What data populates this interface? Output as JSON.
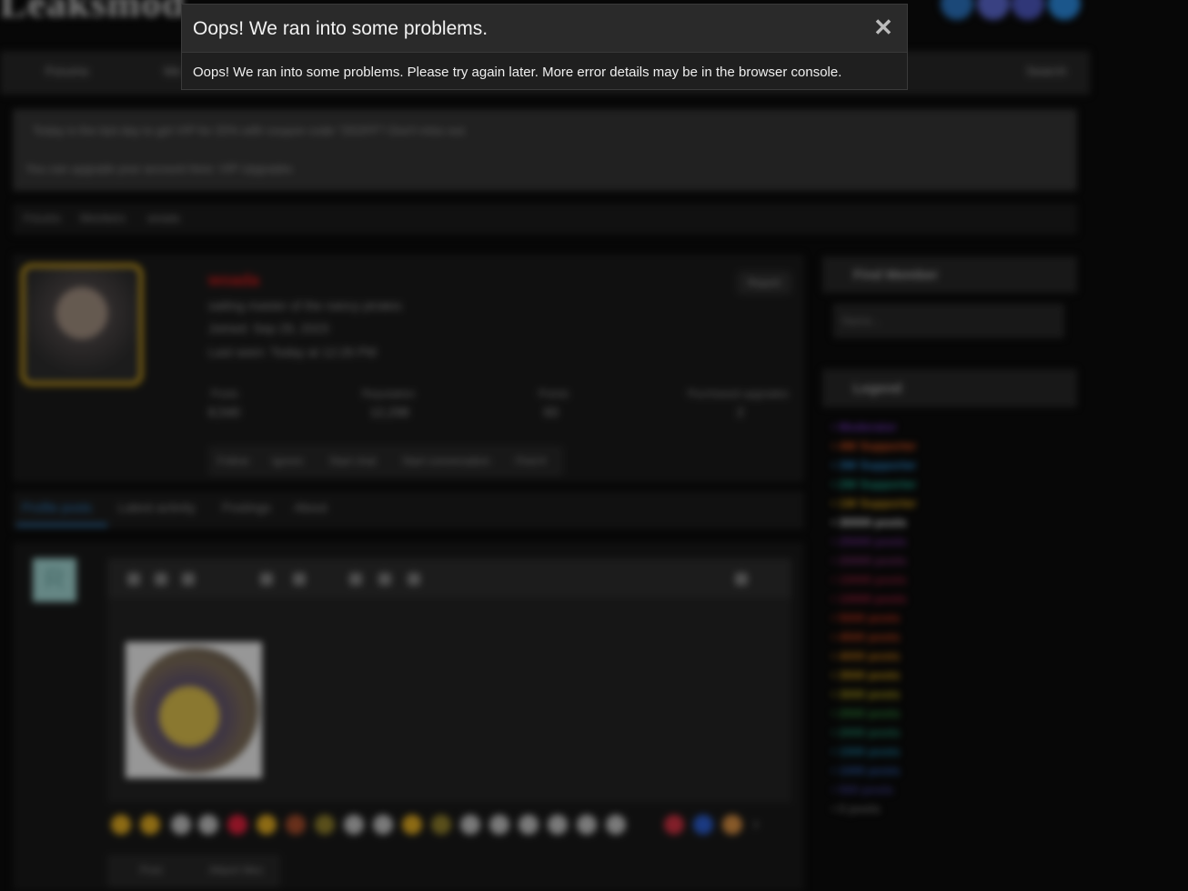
{
  "modal": {
    "title": "Oops! We ran into some problems.",
    "close_glyph": "✕",
    "message": "Oops! We ran into some problems. Please try again later. More error details may be in the browser console."
  },
  "background": {
    "logo_text": "Leaksmod",
    "nav": {
      "forums": "Forums",
      "media": "Me",
      "search": "Search"
    },
    "notice": {
      "line1": "Today is the last day to get VIP for 25% with coupon code \"25OFF\"! Don't miss out.",
      "line2": "You can upgrade your account here: VIP Upgrades"
    },
    "breadcrumb": [
      "Forums",
      "Members",
      "woada"
    ],
    "profile": {
      "username": "woada",
      "title": "sailing master of the nancy pirates",
      "joined": "Joined: Sep 29, 2023",
      "last_seen": "Last seen: Today at 12:26 PM",
      "report": "Report",
      "stats": [
        {
          "label": "Posts",
          "value": "8,540"
        },
        {
          "label": "Reputation",
          "value": "12,298"
        },
        {
          "label": "Points",
          "value": "83"
        },
        {
          "label": "Purchased upgrades",
          "value": "2"
        }
      ],
      "actions": [
        "Follow",
        "Ignore",
        "Start chat",
        "Start conversation",
        "Find ▾"
      ]
    },
    "tabs": [
      "Profile posts",
      "Latest activity",
      "Postings",
      "About"
    ],
    "poster_initial": "R",
    "post_buttons": {
      "post": "Post",
      "attach": "Attach files"
    },
    "sidebar": {
      "find_member": "Find Member",
      "name_placeholder": "Name...",
      "legend_title": "Legend",
      "legend": [
        {
          "text": "• Moderator",
          "color": "#6a2fb0"
        },
        {
          "text": "• 4W Supporter",
          "color": "#e0541e"
        },
        {
          "text": "• 3W Supporter",
          "color": "#2a8fd6"
        },
        {
          "text": "• 2W Supporter",
          "color": "#1aa88f"
        },
        {
          "text": "• 1W Supporter",
          "color": "#d9a21a"
        },
        {
          "text": "• 30000 posts",
          "color": "#e8e8e8"
        },
        {
          "text": "• 25000 posts",
          "color": "#6b2a8a"
        },
        {
          "text": "• 20000 posts",
          "color": "#7a2a6a"
        },
        {
          "text": "• 15000 posts",
          "color": "#8f1e3a"
        },
        {
          "text": "• 10000 posts",
          "color": "#a01e3c"
        },
        {
          "text": "• 5000 posts",
          "color": "#c3321c"
        },
        {
          "text": "• 4500 posts",
          "color": "#c8441a"
        },
        {
          "text": "• 4000 posts",
          "color": "#cc7a14"
        },
        {
          "text": "• 3500 posts",
          "color": "#d4a016"
        },
        {
          "text": "• 3000 posts",
          "color": "#b8a81a"
        },
        {
          "text": "• 2500 posts",
          "color": "#2e8a3a"
        },
        {
          "text": "• 2000 posts",
          "color": "#1e8a6a"
        },
        {
          "text": "• 1500 posts",
          "color": "#1a7ea3"
        },
        {
          "text": "• 1000 posts",
          "color": "#2a5aa8"
        },
        {
          "text": "• 500 posts",
          "color": "#3a3a88"
        },
        {
          "text": "• 0 posts",
          "color": "#6a6a6a"
        }
      ]
    }
  }
}
